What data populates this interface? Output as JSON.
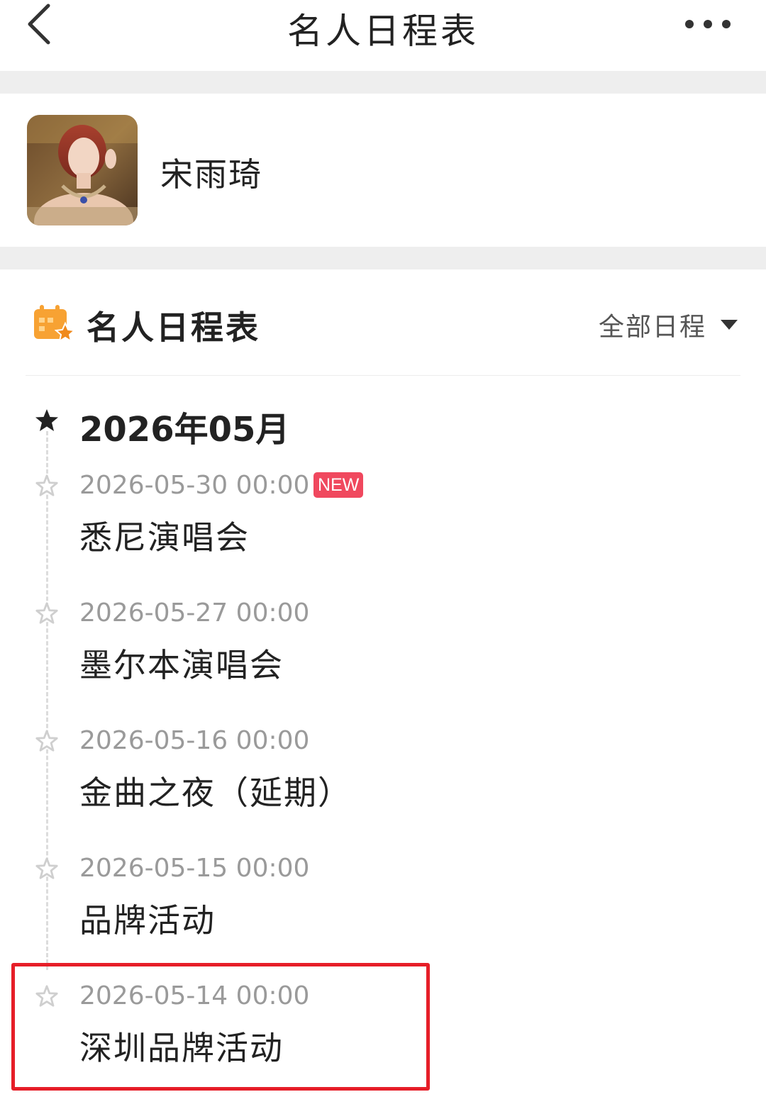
{
  "header": {
    "title": "名人日程表"
  },
  "profile": {
    "name": "宋雨琦"
  },
  "section": {
    "title": "名人日程表",
    "filter_label": "全部日程"
  },
  "timeline": {
    "month": "2026年05月",
    "events": [
      {
        "time": "2026-05-30 00:00",
        "title": "悉尼演唱会",
        "badge": "NEW"
      },
      {
        "time": "2026-05-27 00:00",
        "title": "墨尔本演唱会"
      },
      {
        "time": "2026-05-16 00:00",
        "title": "金曲之夜（延期）"
      },
      {
        "time": "2026-05-15 00:00",
        "title": "品牌活动"
      },
      {
        "time": "2026-05-14 00:00",
        "title": "深圳品牌活动"
      }
    ]
  },
  "colors": {
    "accent_badge": "#f0485e",
    "highlight": "#e61e28",
    "icon_orange": "#f7a233"
  }
}
